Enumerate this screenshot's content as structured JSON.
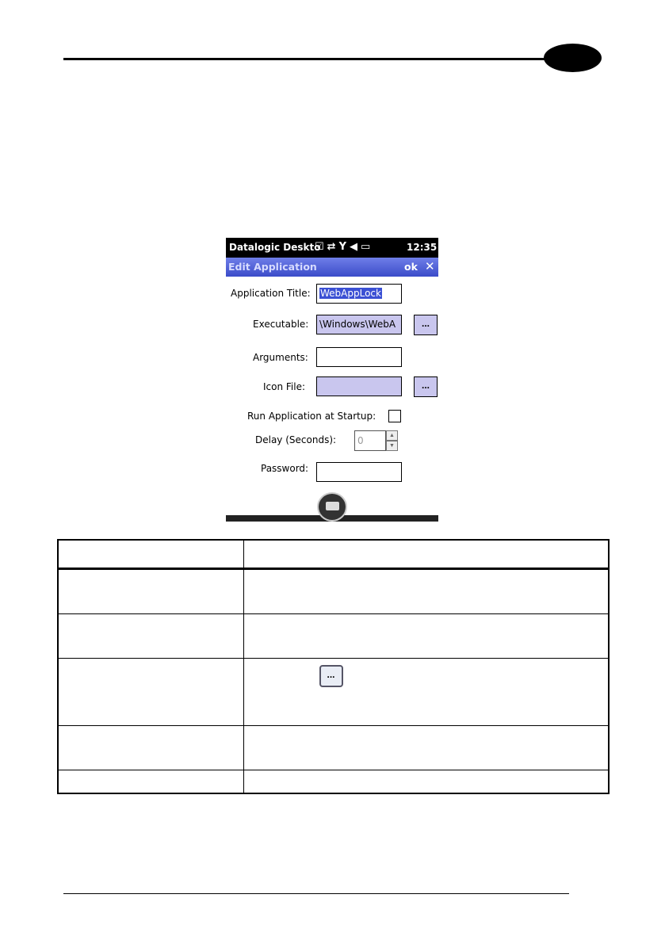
{
  "device": {
    "status_bar": {
      "app_name": "Datalogic Deskto",
      "icons": [
        "checkbox-icon",
        "sync-icon",
        "no-signal-icon",
        "mute-icon",
        "battery-icon"
      ],
      "time": "12:35"
    },
    "title_bar": {
      "title": "Edit Application",
      "ok_label": "ok",
      "close_label": "✕"
    },
    "form": {
      "application_title": {
        "label": "Application Title:",
        "value": "WebAppLock"
      },
      "executable": {
        "label": "Executable:",
        "value": "\\Windows\\WebA",
        "browse_label": "..."
      },
      "arguments": {
        "label": "Arguments:",
        "value": ""
      },
      "icon_file": {
        "label": "Icon File:",
        "value": "",
        "browse_label": "..."
      },
      "run_at_startup": {
        "label": "Run Application at Startup:",
        "checked": false
      },
      "delay": {
        "label": "Delay (Seconds):",
        "value": "0"
      },
      "password": {
        "label": "Password:",
        "value": ""
      }
    }
  },
  "table": {
    "inline_button_label": "..."
  },
  "colors": {
    "titlebar": "#4a5bd6",
    "field_fill": "#c9c6ee",
    "selection": "#3b50d4"
  }
}
